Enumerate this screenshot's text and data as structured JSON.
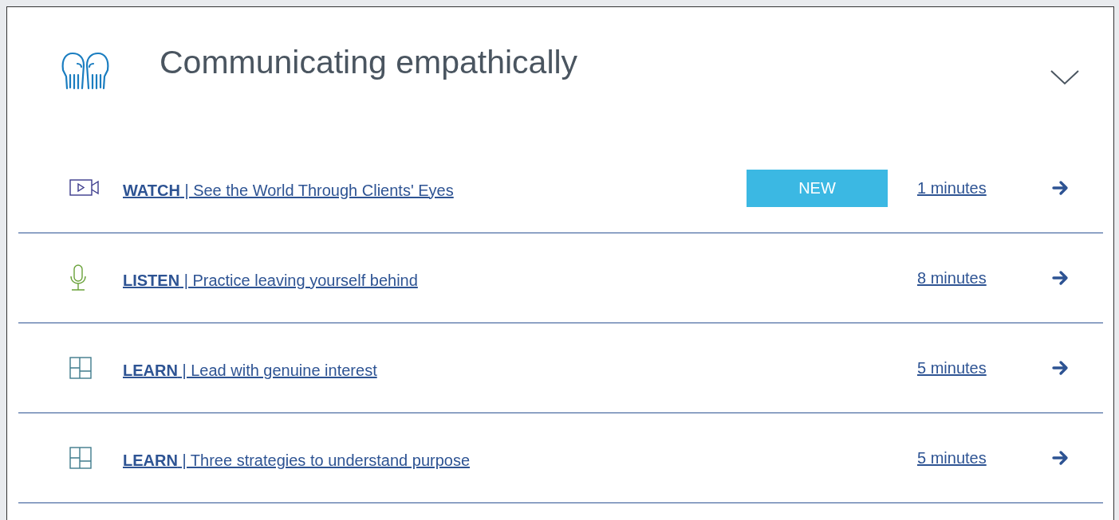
{
  "section": {
    "title": "Communicating empathically"
  },
  "items": [
    {
      "kind": "video",
      "link": "**WATCH** | See the World Through Clients' Eyes",
      "badge": "NEW",
      "duration": "1 minutes"
    },
    {
      "kind": "audio",
      "link": "**LISTEN** | Practice leaving yourself behind",
      "duration": "8 minutes"
    },
    {
      "kind": "article",
      "link": "**LEARN** | Lead with genuine interest",
      "duration": "5 minutes"
    },
    {
      "kind": "article",
      "link": "**LEARN** | Three strategies to understand purpose",
      "duration": "5 minutes"
    }
  ]
}
